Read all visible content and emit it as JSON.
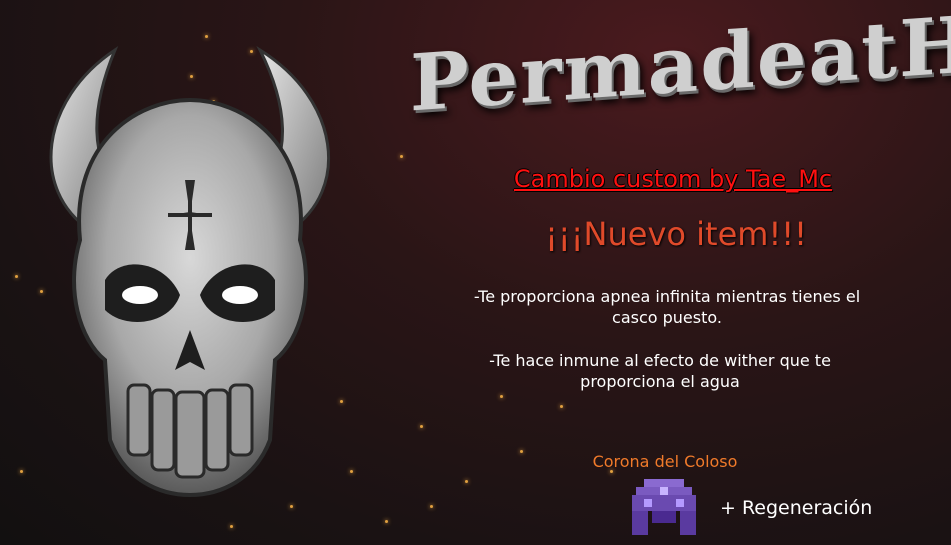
{
  "header": {
    "title": "PermadeatH"
  },
  "announcement": {
    "custom_change": "Cambio custom by Tae_Mc",
    "new_item": "¡¡¡Nuevo item!!!",
    "benefit_1": "-Te proporciona apnea infinita mientras tienes el casco puesto.",
    "benefit_2": "-Te hace inmune al efecto de wither que te proporciona el agua"
  },
  "item": {
    "name": "Corona del Coloso",
    "icon": "corona-helmet-icon",
    "bonus": "+ Regeneración"
  },
  "colors": {
    "title": "#cfcfcf",
    "custom_change": "#ff1010",
    "new_item": "#e04a2a",
    "item_name": "#f07a2a",
    "icon_purple": "#6a4ab0"
  },
  "decoration": {
    "logo": "horned-skull-icon"
  }
}
